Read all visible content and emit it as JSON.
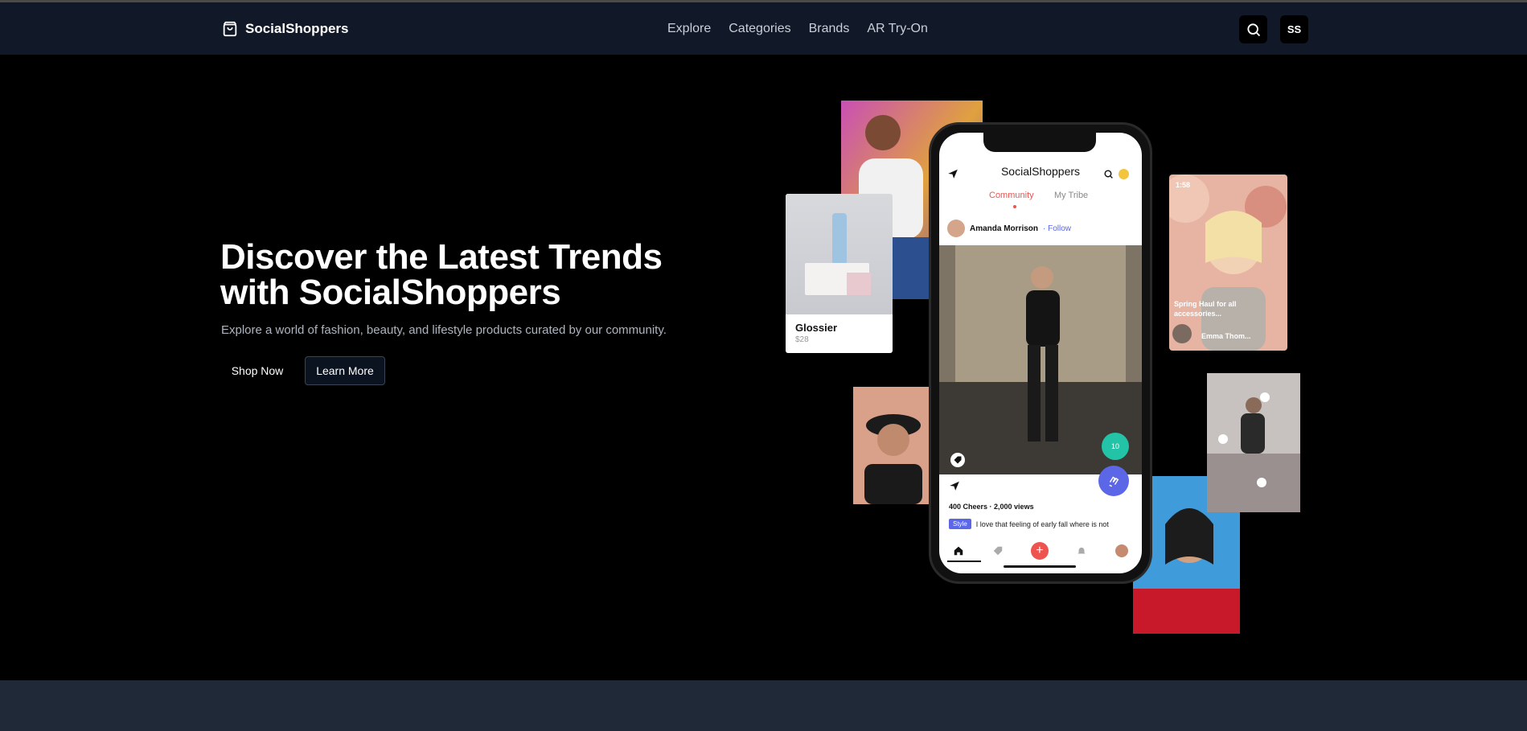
{
  "brand": {
    "name": "SocialShoppers"
  },
  "nav": {
    "links": [
      "Explore",
      "Categories",
      "Brands",
      "AR Try-On"
    ]
  },
  "header": {
    "avatar_initials": "SS"
  },
  "hero": {
    "headline": "Discover the Latest Trends with SocialShoppers",
    "subtitle": "Explore a world of fashion, beauty, and lifestyle products curated by our community.",
    "shop_label": "Shop Now",
    "learn_label": "Learn More"
  },
  "product_card": {
    "name": "Glossier",
    "price": "$28"
  },
  "phone": {
    "app_title": "SocialShoppers",
    "tab_active": "Community",
    "tab_other": "My Tribe",
    "poster_name": "Amanda Morrison",
    "follow_label": "· Follow",
    "badge_count": "10",
    "stats": "400 Cheers · 2,000 views",
    "tag": "Style",
    "caption": "I love that feeling of early fall where is not"
  },
  "story": {
    "time": "1:58",
    "caption": "Spring  Haul for all accessories...",
    "user": "Emma Thom..."
  },
  "colors": {
    "nav_bg": "#111827",
    "accent_red": "#ef5350",
    "accent_blue": "#5b67e6",
    "accent_teal": "#22c3a6"
  }
}
